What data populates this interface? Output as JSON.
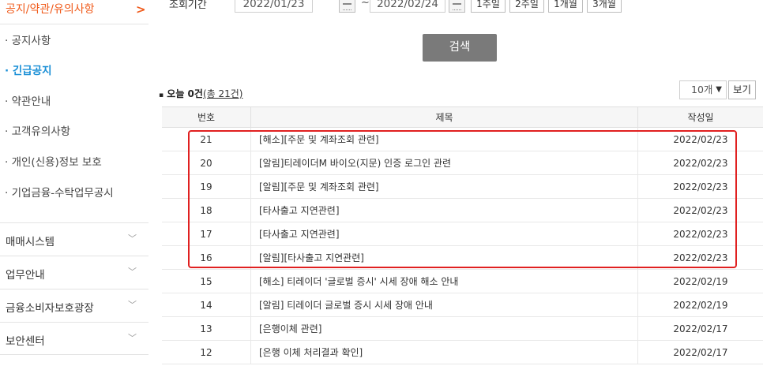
{
  "sidebar": {
    "header": {
      "label": "공지/약관/유의사항",
      "arrow": ">"
    },
    "sub_items": [
      {
        "label": "· 공지사항",
        "active": false
      },
      {
        "label": "· 긴급공지",
        "active": true
      },
      {
        "label": "· 약관안내",
        "active": false
      },
      {
        "label": "· 고객유의사항",
        "active": false
      },
      {
        "label": "· 개인(신용)정보 보호",
        "active": false
      },
      {
        "label": "· 기업금융-수탁업무공시",
        "active": false
      }
    ],
    "main_items": [
      {
        "label": "매매시스템"
      },
      {
        "label": "업무안내"
      },
      {
        "label": "금융소비자보호광장"
      },
      {
        "label": "보안센터"
      }
    ]
  },
  "search": {
    "period_label": "조회기간",
    "start_date": "2022/01/23",
    "end_date": "2022/02/24",
    "separator": "~",
    "range_buttons": [
      "1주일",
      "2주일",
      "1개월",
      "3개월"
    ],
    "search_button": "검색"
  },
  "list_info": {
    "today_count": "오늘 0건",
    "total_count": "(총 21건)",
    "per_page": "10개",
    "view_button": "보기"
  },
  "table": {
    "headers": {
      "no": "번호",
      "title": "제목",
      "date": "작성일"
    },
    "rows": [
      {
        "no": "21",
        "title": "[해소][주문 및 계좌조회 관련]",
        "date": "2022/02/23"
      },
      {
        "no": "20",
        "title": "[알림]티레이더M 바이오(지문) 인증 로그인 관련",
        "date": "2022/02/23"
      },
      {
        "no": "19",
        "title": "[알림][주문 및 계좌조회 관련]",
        "date": "2022/02/23"
      },
      {
        "no": "18",
        "title": "[타사출고 지연관련]",
        "date": "2022/02/23"
      },
      {
        "no": "17",
        "title": "[타사출고 지연관련]",
        "date": "2022/02/23"
      },
      {
        "no": "16",
        "title": "[알림][타사출고 지연관련]",
        "date": "2022/02/23"
      },
      {
        "no": "15",
        "title": "[해소] 티레이더 '글로벌 증시' 시세 장애 해소 안내",
        "date": "2022/02/19"
      },
      {
        "no": "14",
        "title": "[알림] 티레이더 글로벌 증시 시세 장애 안내",
        "date": "2022/02/19"
      },
      {
        "no": "13",
        "title": "[은행이체 관련]",
        "date": "2022/02/17"
      },
      {
        "no": "12",
        "title": "[은행 이체 처리결과 확인]",
        "date": "2022/02/17"
      }
    ]
  },
  "colors": {
    "accent": "#f05a1a",
    "active_link": "#1a8fd6",
    "highlight": "#e02020",
    "search_button": "#7a7a7a"
  }
}
